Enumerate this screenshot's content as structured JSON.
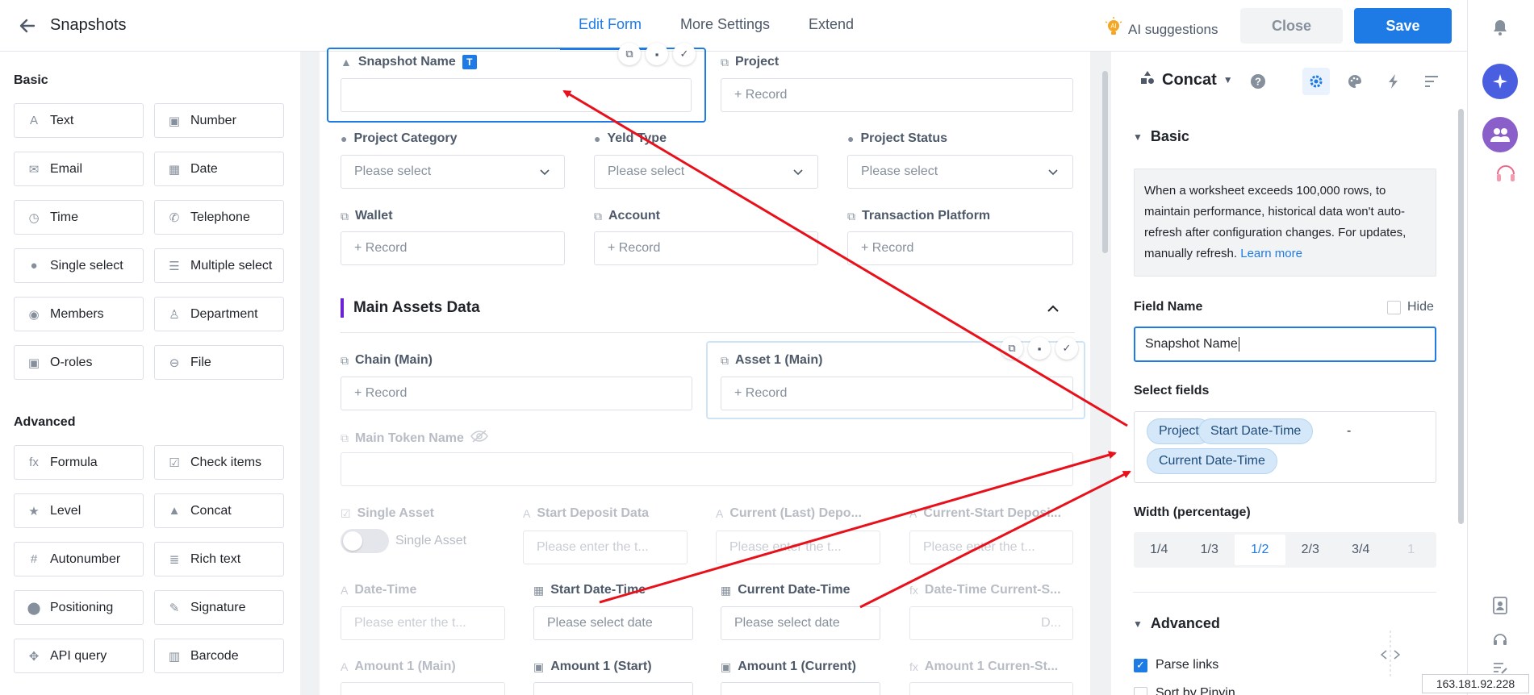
{
  "header": {
    "title": "Snapshots",
    "tabs": [
      "Edit Form",
      "More Settings",
      "Extend"
    ],
    "ai_label": "AI suggestions",
    "close_label": "Close",
    "save_label": "Save"
  },
  "left": {
    "basic_title": "Basic",
    "advanced_title": "Advanced",
    "basic": [
      {
        "label": "Text",
        "icon": "text-icon"
      },
      {
        "label": "Number",
        "icon": "number-icon"
      },
      {
        "label": "Email",
        "icon": "email-icon"
      },
      {
        "label": "Date",
        "icon": "date-icon"
      },
      {
        "label": "Time",
        "icon": "clock-icon"
      },
      {
        "label": "Telephone",
        "icon": "phone-icon"
      },
      {
        "label": "Single select",
        "icon": "single-select-icon"
      },
      {
        "label": "Multiple select",
        "icon": "multiple-select-icon"
      },
      {
        "label": "Members",
        "icon": "member-icon"
      },
      {
        "label": "Department",
        "icon": "department-icon"
      },
      {
        "label": "O-roles",
        "icon": "role-icon"
      },
      {
        "label": "File",
        "icon": "attachment-icon"
      }
    ],
    "advanced": [
      {
        "label": "Formula",
        "icon": "formula-icon"
      },
      {
        "label": "Check items",
        "icon": "check-items-icon"
      },
      {
        "label": "Level",
        "icon": "star-icon"
      },
      {
        "label": "Concat",
        "icon": "concat-icon"
      },
      {
        "label": "Autonumber",
        "icon": "hash-icon"
      },
      {
        "label": "Rich text",
        "icon": "rich-text-icon"
      },
      {
        "label": "Positioning",
        "icon": "location-icon"
      },
      {
        "label": "Signature",
        "icon": "signature-icon"
      },
      {
        "label": "API query",
        "icon": "api-icon"
      },
      {
        "label": "Barcode",
        "icon": "barcode-icon"
      }
    ]
  },
  "form": {
    "record_placeholder": "+ Record",
    "select_placeholder": "Please select",
    "date_placeholder": "Please select date",
    "text_placeholder": "Please enter the t...",
    "snapshot_name": "Snapshot Name",
    "project": "Project",
    "project_category": "Project Category",
    "yeld_type": "Yeld Type",
    "project_status": "Project Status",
    "wallet": "Wallet",
    "account": "Account",
    "transaction_platform": "Transaction Platform",
    "section_title": "Main Assets Data",
    "chain_main": "Chain (Main)",
    "asset1_main": "Asset 1 (Main)",
    "main_token_name": "Main Token Name",
    "single_asset": "Single Asset",
    "single_asset_toggle": "Single Asset",
    "start_deposit_data": "Start Deposit Data",
    "current_last_deposit": "Current (Last) Depo...",
    "current_start_deposit": "Current-Start Deposi...",
    "date_time": "Date-Time",
    "start_date_time": "Start Date-Time",
    "current_date_time": "Current Date-Time",
    "date_time_current_s": "Date-Time Current-S...",
    "date_time_formula_value": "D...",
    "amount1_main": "Amount 1 (Main)",
    "amount1_start": "Amount 1 (Start)",
    "amount1_current": "Amount 1 (Current)",
    "amount1_current_st": "Amount 1 Curren-St...",
    "t_badge": "T"
  },
  "props": {
    "type_name": "Concat",
    "basic_title": "Basic",
    "note": "When a worksheet exceeds 100,000 rows, to maintain performance, historical data won't auto-refresh after configuration changes. For updates, manually refresh.",
    "learn_more": "Learn more",
    "field_name_label": "Field Name",
    "hide_label": "Hide",
    "field_name_value": "Snapshot Name",
    "select_fields_label": "Select fields",
    "chips": [
      "Project",
      "Start Date-Time",
      "Current Date-Time"
    ],
    "separator": "-",
    "width_label": "Width (percentage)",
    "widths": [
      "1/4",
      "1/3",
      "1/2",
      "2/3",
      "3/4",
      "1"
    ],
    "width_selected": "1/2",
    "advanced_title": "Advanced",
    "parse_links": "Parse links",
    "sort_pinyin": "Sort by Pinyin"
  },
  "status": {
    "ip": "163.181.92.228"
  },
  "colors": {
    "accent": "#1e7be5",
    "annotation_arrow": "#e8101a",
    "section_marker": "#6b21d6"
  }
}
